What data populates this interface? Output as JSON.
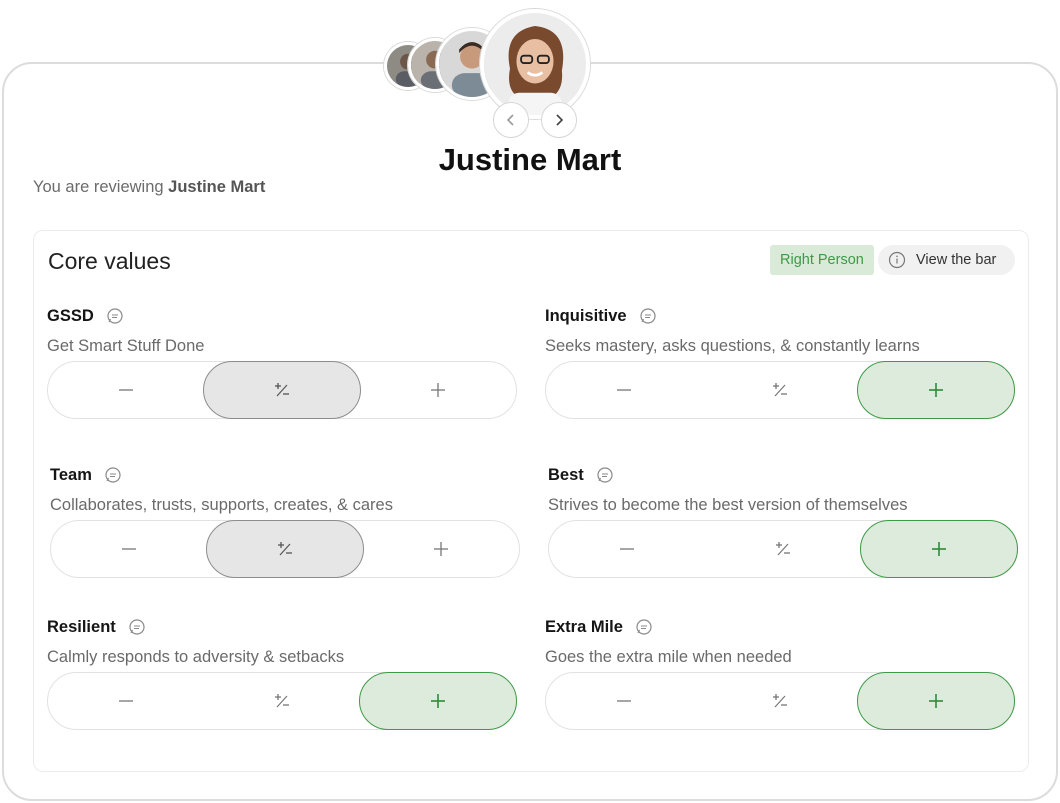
{
  "person": {
    "name": "Justine Mart",
    "reviewing_prefix": "You are reviewing",
    "reviewing_name": "Justine Mart"
  },
  "card": {
    "title": "Core values",
    "badge": "Right Person",
    "view_bar": "View the bar"
  },
  "values": [
    {
      "name": "GSSD",
      "desc": "Get Smart Stuff Done",
      "selected": "neutral"
    },
    {
      "name": "Inquisitive",
      "desc": "Seeks mastery, asks questions, & constantly learns",
      "selected": "plus"
    },
    {
      "name": "Team",
      "desc": "Collaborates, trusts, supports, creates, & cares",
      "selected": "neutral"
    },
    {
      "name": "Best",
      "desc": "Strives to become the best version of themselves",
      "selected": "plus"
    },
    {
      "name": "Resilient",
      "desc": "Calmly responds to adversity & setbacks",
      "selected": "plus"
    },
    {
      "name": "Extra Mile",
      "desc": "Goes the extra mile when needed",
      "selected": "plus"
    }
  ],
  "colors": {
    "accent_green": "#3f9a47",
    "green_bg": "#dcebdc",
    "neutral_bg": "#e6e6e6"
  },
  "icons": {
    "prev": "chevron-left-icon",
    "next": "chevron-right-icon",
    "info": "info-icon",
    "comment": "comment-icon",
    "minus": "minus-icon",
    "plus_minus": "plus-minus-icon",
    "plus": "plus-icon"
  }
}
